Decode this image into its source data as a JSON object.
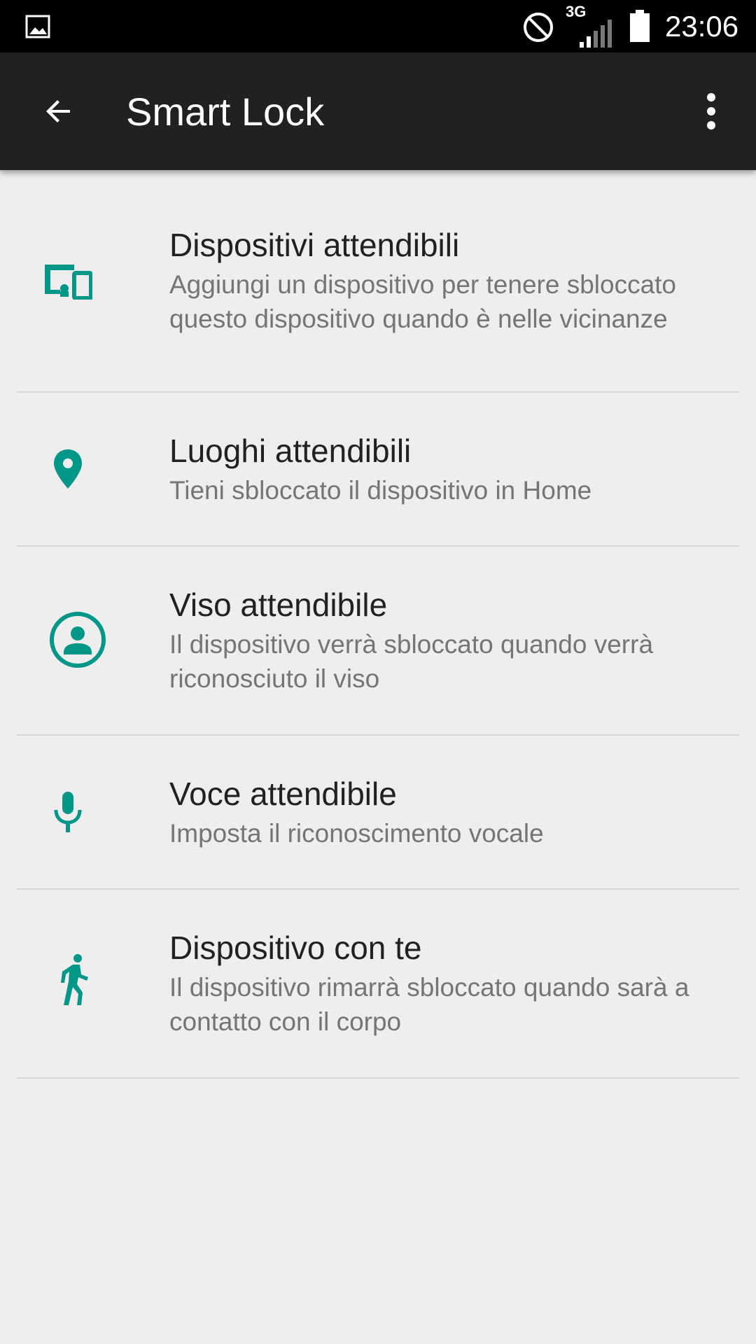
{
  "status_bar": {
    "network": "3G",
    "time": "23:06"
  },
  "app_bar": {
    "title": "Smart Lock",
    "back_icon": "arrow-back-icon",
    "overflow_icon": "more-vert-icon"
  },
  "colors": {
    "accent": "#009688",
    "app_bar": "#212121",
    "background": "#eeeeee"
  },
  "items": [
    {
      "title": "Dispositivi attendibili",
      "subtitle": "Aggiungi un dispositivo per tenere sbloccato questo dispositivo quando è nelle vicinanze",
      "icon": "devices-icon"
    },
    {
      "title": "Luoghi attendibili",
      "subtitle": "Tieni sbloccato il dispositivo in Home",
      "icon": "location-pin-icon"
    },
    {
      "title": "Viso attendibile",
      "subtitle": "Il dispositivo verrà sbloccato quando verrà riconosciuto il viso",
      "icon": "face-icon"
    },
    {
      "title": "Voce attendibile",
      "subtitle": "Imposta il riconoscimento vocale",
      "icon": "microphone-icon"
    },
    {
      "title": "Dispositivo con te",
      "subtitle": "Il dispositivo rimarrà sbloccato quando sarà a contatto con il corpo",
      "icon": "walking-person-icon"
    }
  ]
}
